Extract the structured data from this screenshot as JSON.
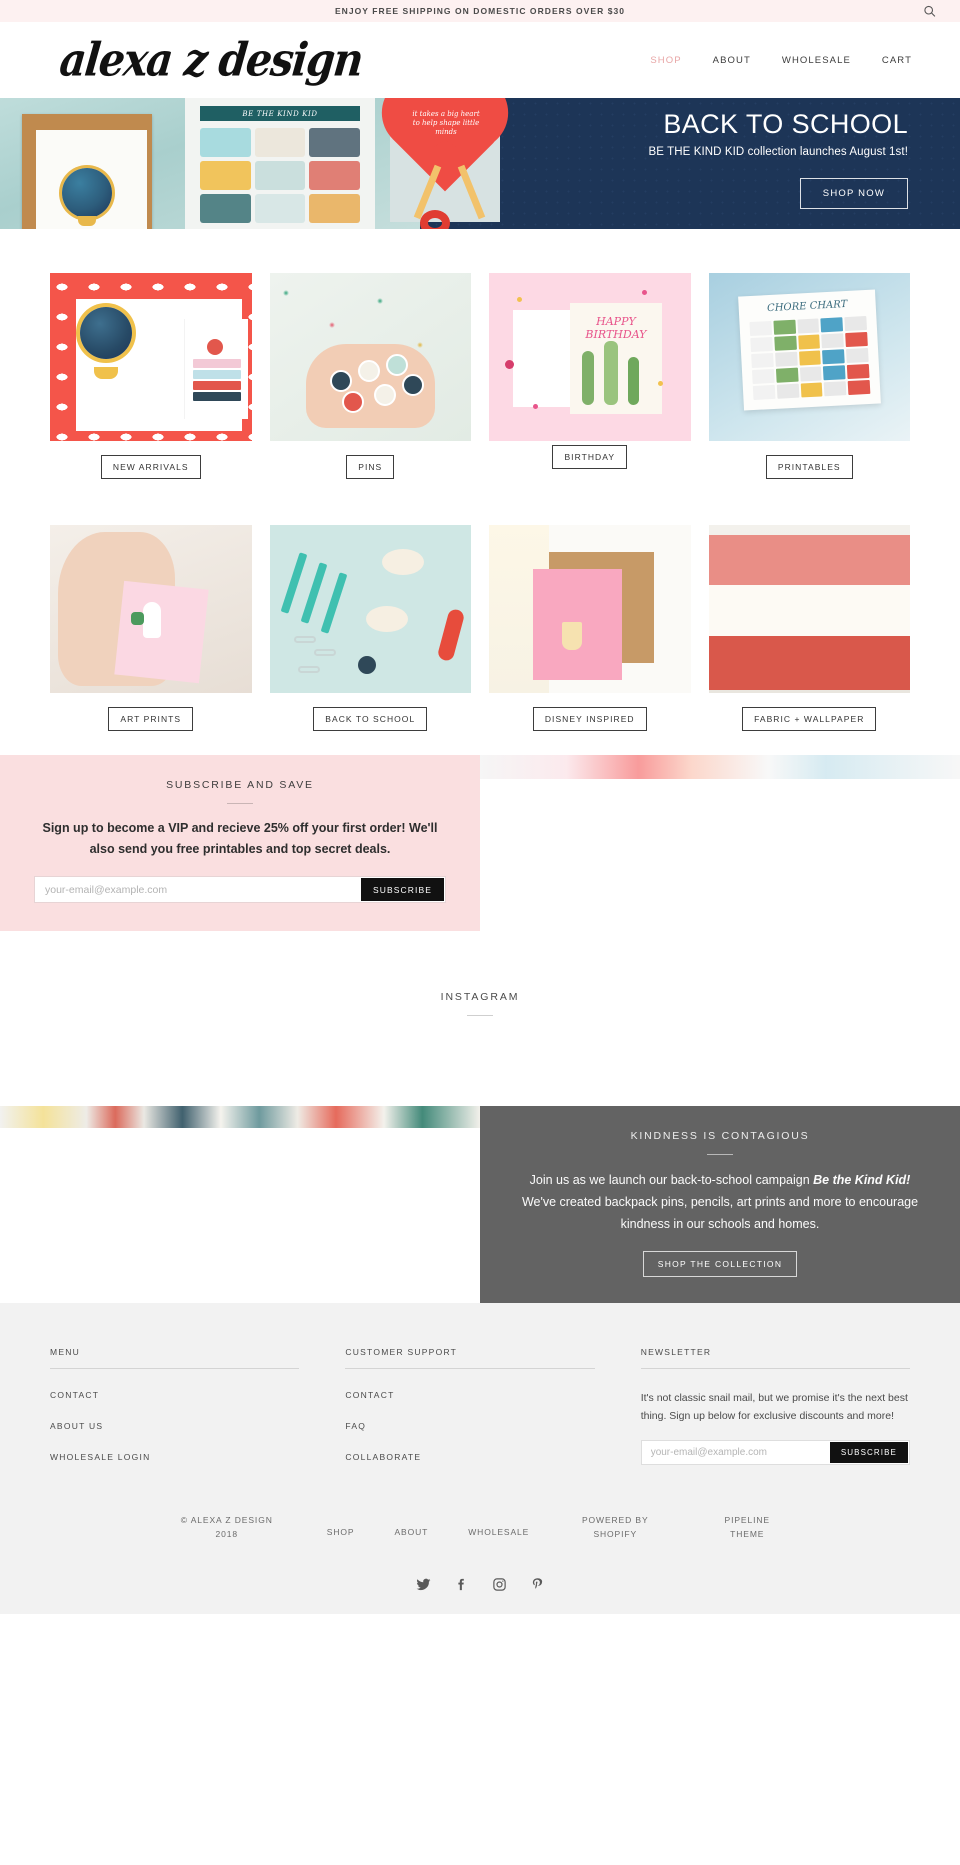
{
  "announcement": {
    "text": "ENJOY FREE SHIPPING ON DOMESTIC ORDERS OVER $30",
    "search_icon": "search-icon"
  },
  "header": {
    "logo": "alexa z design",
    "nav": [
      {
        "label": "SHOP",
        "active": true
      },
      {
        "label": "ABOUT",
        "active": false
      },
      {
        "label": "WHOLESALE",
        "active": false
      },
      {
        "label": "CART",
        "active": false
      }
    ]
  },
  "hero": {
    "title": "BACK TO SCHOOL",
    "subtitle": "BE THE KIND KID collection launches August 1st!",
    "button": "SHOP NOW",
    "banner_text": "BE THE KIND KID",
    "card_text": "it takes a big heart to help shape little minds",
    "bg_color": "#1d3557"
  },
  "categories": {
    "row1": [
      {
        "label": "NEW ARRIVALS"
      },
      {
        "label": "PINS"
      },
      {
        "label": "BIRTHDAY"
      },
      {
        "label": "PRINTABLES"
      }
    ],
    "row2": [
      {
        "label": "ART PRINTS"
      },
      {
        "label": "BACK TO SCHOOL"
      },
      {
        "label": "DISNEY INSPIRED"
      },
      {
        "label": "FABRIC + WALLPAPER"
      }
    ],
    "chart_label": "CHORE CHART",
    "birthday_label": "HAPPY BIRTHDAY"
  },
  "subscribe": {
    "heading": "SUBSCRIBE AND SAVE",
    "body_1": "Sign up to become a VIP and recieve ",
    "body_bold": "25% off your first order!",
    "body_2": " We'll also send you free printables and top secret deals.",
    "placeholder": "your-email@example.com",
    "button": "SUBSCRIBE",
    "bg_color": "#fadfe0"
  },
  "instagram": {
    "heading": "INSTAGRAM"
  },
  "kindness": {
    "heading": "KINDNESS IS CONTAGIOUS",
    "body_1": "Join us as we launch our back-to-school campaign ",
    "body_em": "Be the Kind Kid!",
    "body_2": "  We've created backpack pins, pencils, art prints and more to encourage kindness in our schools and homes.",
    "button": "SHOP THE COLLECTION",
    "bg_color": "#636363"
  },
  "footer": {
    "menu": {
      "title": "MENU",
      "links": [
        "CONTACT",
        "ABOUT US",
        "WHOLESALE LOGIN"
      ]
    },
    "support": {
      "title": "CUSTOMER SUPPORT",
      "links": [
        "CONTACT",
        "FAQ",
        "COLLABORATE"
      ]
    },
    "newsletter": {
      "title": "NEWSLETTER",
      "text": "It's not classic snail mail, but we promise it's the next best thing. Sign up below for exclusive discounts and more!",
      "placeholder": "your-email@example.com",
      "button": "SUBSCRIBE"
    },
    "bottom": {
      "copyright_line1": "© ALEXA Z DESIGN",
      "copyright_line2": "2018",
      "links": [
        "SHOP",
        "ABOUT",
        "WHOLESALE"
      ],
      "powered_line1": "POWERED BY",
      "powered_line2": "SHOPIFY",
      "theme_line1": "PIPELINE",
      "theme_line2": "THEME"
    },
    "socials": [
      "twitter-icon",
      "facebook-icon",
      "instagram-icon",
      "pinterest-icon"
    ]
  }
}
